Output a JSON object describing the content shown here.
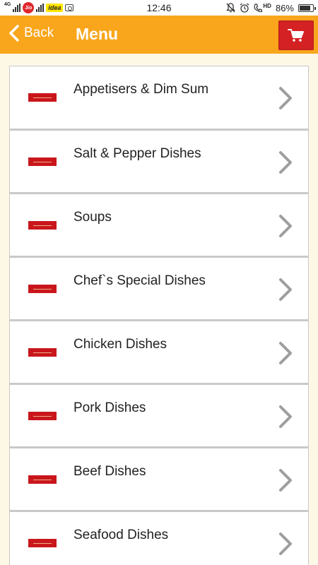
{
  "status_bar": {
    "network_type": "4G",
    "carrier_jio": "Jio",
    "carrier_idea": "idea",
    "time": "12:46",
    "data_type": "HD",
    "battery": "86%"
  },
  "header": {
    "back_label": "Back",
    "title": "Menu"
  },
  "menu": {
    "items": [
      {
        "label": "Appetisers & Dim Sum"
      },
      {
        "label": "Salt & Pepper Dishes"
      },
      {
        "label": "Soups"
      },
      {
        "label": "Chef`s Special Dishes"
      },
      {
        "label": "Chicken Dishes"
      },
      {
        "label": "Pork Dishes"
      },
      {
        "label": "Beef Dishes"
      },
      {
        "label": "Seafood Dishes"
      }
    ]
  },
  "icons": {
    "back": "chevron-left-icon",
    "cart": "shopping-cart-icon",
    "item_arrow": "chevron-right-icon",
    "item_logo": "restaurant-logo"
  },
  "colors": {
    "header_bg": "#f9a61c",
    "cart_bg": "#d42124",
    "page_bg": "#fdf7e6",
    "logo_red": "#c9161c",
    "chevron_grey": "#9e9e9e"
  }
}
